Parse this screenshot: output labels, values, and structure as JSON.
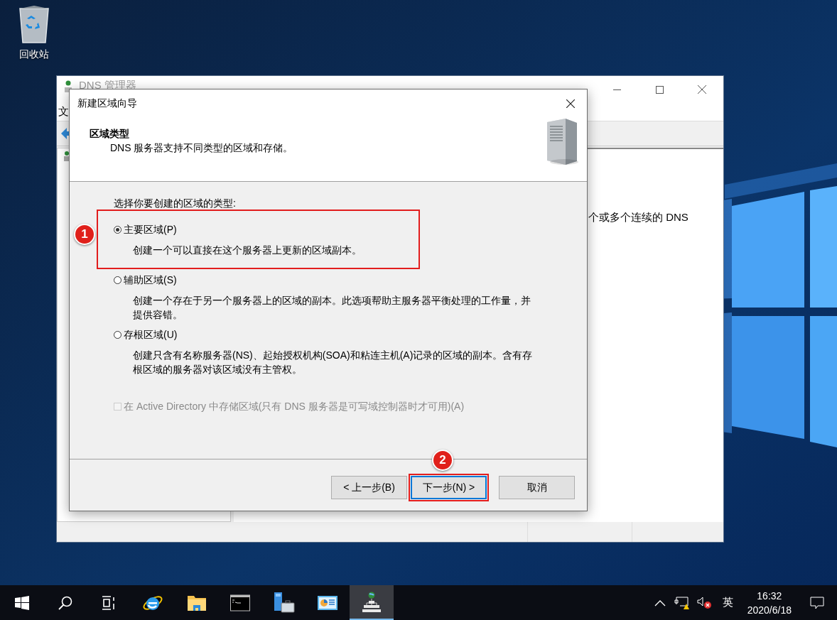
{
  "desktop_icons": [
    {
      "label": "回收站"
    }
  ],
  "background_window": {
    "title": "DNS 管理器",
    "menu": [
      "文"
    ],
    "content_text": "个或多个连续的 DNS"
  },
  "dialog": {
    "title": "新建区域向导",
    "header": {
      "title": "区域类型",
      "subtitle": "DNS 服务器支持不同类型的区域和存储。"
    },
    "prompt": "选择你要创建的区域的类型:",
    "options": [
      {
        "label": "主要区域(P)",
        "description": "创建一个可以直接在这个服务器上更新的区域副本。",
        "selected": true,
        "annotation": "1"
      },
      {
        "label": "辅助区域(S)",
        "description": "创建一个存在于另一个服务器上的区域的副本。此选项帮助主服务器平衡处理的工作量，并提供容错。",
        "selected": false
      },
      {
        "label": "存根区域(U)",
        "description": "创建只含有名称服务器(NS)、起始授权机构(SOA)和粘连主机(A)记录的区域的副本。含有存根区域的服务器对该区域没有主管权。",
        "selected": false
      }
    ],
    "ad_checkbox": {
      "label": "在 Active Directory 中存储区域(只有 DNS 服务器是可写域控制器时才可用)(A)",
      "checked": false,
      "disabled": true
    },
    "buttons": [
      {
        "label": "< 上一步(B)",
        "focused": false
      },
      {
        "label": "下一步(N) >",
        "focused": true,
        "annotation": "2"
      },
      {
        "label": "取消",
        "focused": false
      }
    ]
  },
  "taskbar": {
    "items": [
      {
        "kind": "start",
        "selected": false
      },
      {
        "kind": "search",
        "selected": false
      },
      {
        "kind": "task_view",
        "selected": false
      },
      {
        "kind": "browser",
        "selected": false
      },
      {
        "kind": "folder",
        "selected": false
      },
      {
        "kind": "terminal",
        "selected": false
      },
      {
        "kind": "server_manager",
        "selected": false
      },
      {
        "kind": "control_panel",
        "selected": false
      },
      {
        "kind": "dns",
        "selected": true
      }
    ],
    "ime": "英",
    "time": "16:32",
    "date": "2020/6/18"
  }
}
